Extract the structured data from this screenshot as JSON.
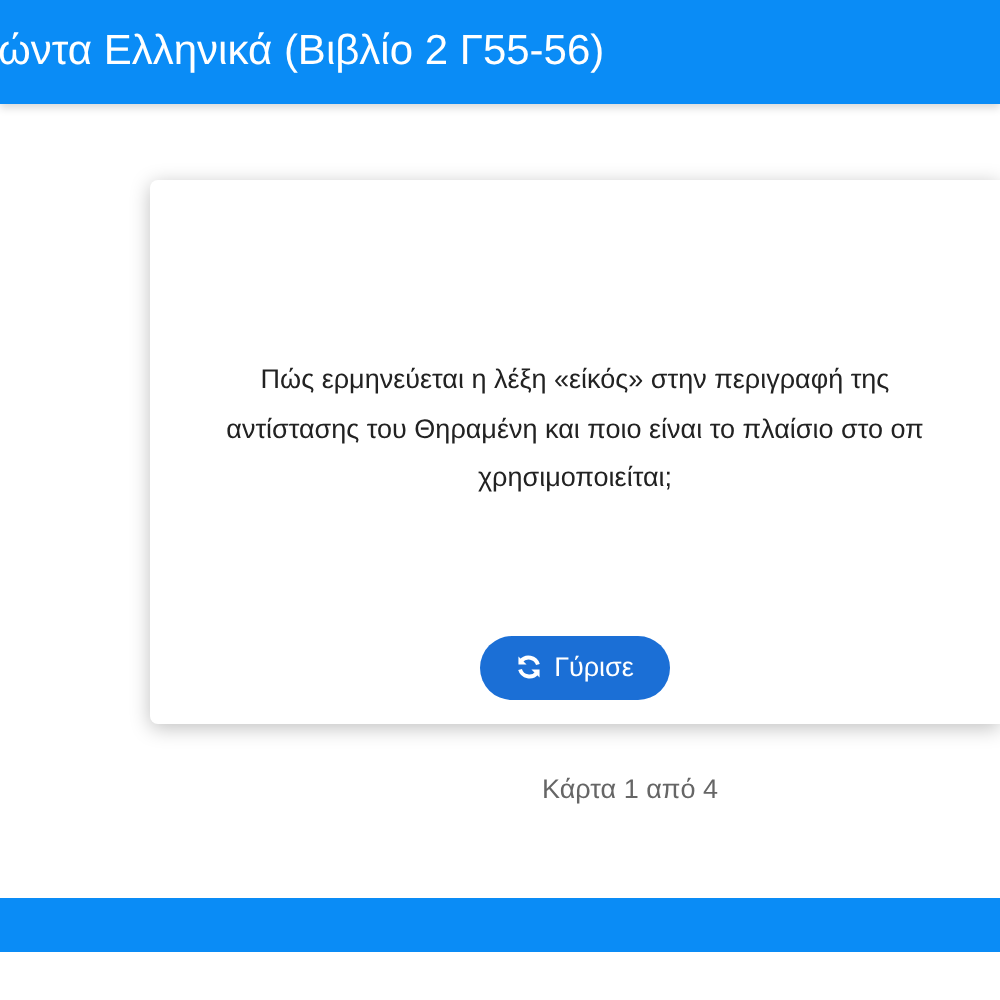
{
  "header": {
    "title": "ώντα Ελληνικά (Βιβλίο 2 Γ55-56)"
  },
  "card": {
    "question_lines": [
      "Πώς ερμηνεύεται η λέξη «είκός» στην περιγραφή της",
      "αντίστασης του Θηραμένη και ποιο είναι το πλαίσιο στο οπ",
      "χρησιμοποιείται;"
    ],
    "flip_button": "Γύρισε"
  },
  "counter": "Κάρτα 1 από 4"
}
